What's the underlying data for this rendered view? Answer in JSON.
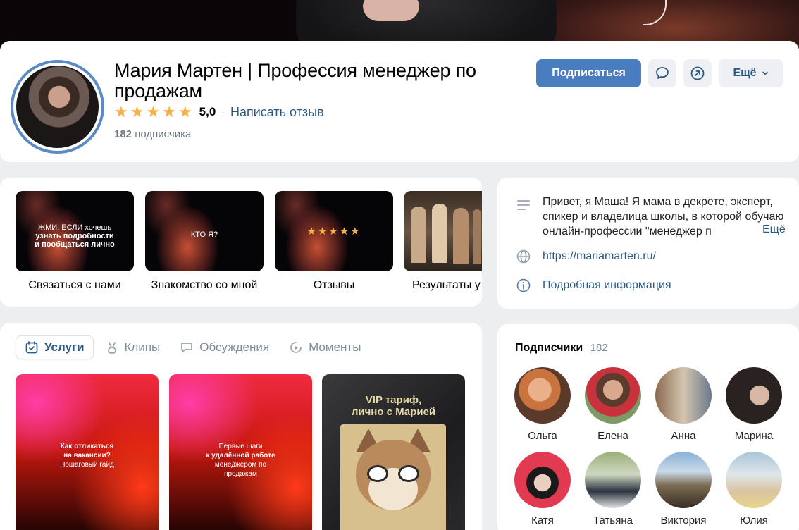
{
  "profile": {
    "name": "Мария Мартен | Профессия менеджер по продажам",
    "rating_value": "5,0",
    "review_link": "Написать отзыв",
    "subscribers_count": "182",
    "subscribers_label": "подписчика"
  },
  "actions": {
    "subscribe": "Подписаться",
    "more": "Ещё"
  },
  "stories": [
    {
      "caption": "Связаться с нами",
      "line1": "ЖМИ, ЕСЛИ хочешь",
      "line2": "узнать подробности",
      "line3": "и пообщаться лично"
    },
    {
      "caption": "Знакомство со мной",
      "line1": "КТО Я?"
    },
    {
      "caption": "Отзывы",
      "stars": "★★★★★"
    },
    {
      "caption": "Результаты у"
    }
  ],
  "about": {
    "description": "Привет, я Маша! Я мама в декрете, эксперт, спикер и владелица школы, в которой обучаю онлайн-профессии \"менеджер п",
    "more": "Ещё",
    "website": "https://mariamarten.ru/",
    "details": "Подробная информация"
  },
  "tabs": [
    {
      "label": "Услуги"
    },
    {
      "label": "Клипы"
    },
    {
      "label": "Обсуждения"
    },
    {
      "label": "Моменты"
    }
  ],
  "services": [
    {
      "line1": "Как отликаться",
      "line2": "на вакансии?",
      "line3": "Пошаговый гайд"
    },
    {
      "line1": "Первые шаги",
      "line2": "к удалённой работе",
      "line3": "менеджером по",
      "line4": "продажам"
    },
    {
      "title1": "VIP тариф,",
      "title2": "лично с Марией"
    }
  ],
  "subscribers": {
    "title": "Подписчики",
    "count": "182",
    "people": [
      "Ольга",
      "Елена",
      "Анна",
      "Марина",
      "Катя",
      "Татьяна",
      "Виктория",
      "Юлия"
    ]
  },
  "colors": {
    "accent": "#4a7cc0",
    "link": "#2a5885",
    "star": "#f5b14a",
    "background": "#edeef0"
  }
}
